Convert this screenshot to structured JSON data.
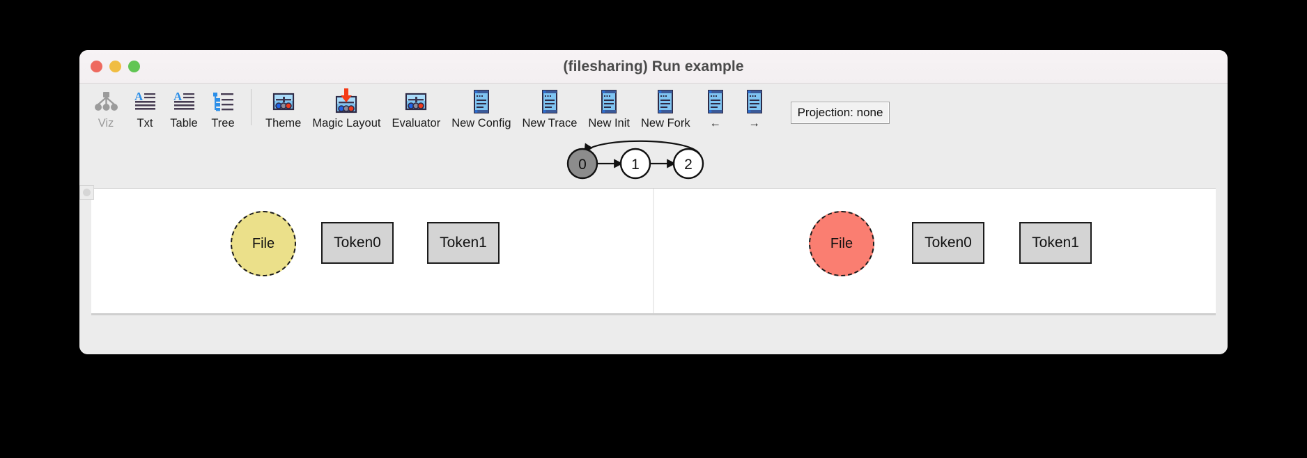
{
  "window": {
    "title": "(filesharing) Run example",
    "traffic_lights": [
      {
        "name": "close",
        "color": "#ee6a5f"
      },
      {
        "name": "minimize",
        "color": "#f0bd42"
      },
      {
        "name": "maximize",
        "color": "#61c554"
      }
    ]
  },
  "toolbar": {
    "items": [
      {
        "label": "Viz",
        "icon": "graph-tree-icon",
        "disabled": true
      },
      {
        "label": "Txt",
        "icon": "text-document-icon",
        "disabled": false
      },
      {
        "label": "Table",
        "icon": "text-table-icon",
        "disabled": false
      },
      {
        "label": "Tree",
        "icon": "tree-outline-icon",
        "disabled": false
      },
      {
        "label": "Theme",
        "icon": "theme-panel-icon",
        "disabled": false
      },
      {
        "label": "Magic Layout",
        "icon": "magic-layout-icon",
        "disabled": false
      },
      {
        "label": "Evaluator",
        "icon": "evaluator-panel-icon",
        "disabled": false
      },
      {
        "label": "New Config",
        "icon": "scroll-document-icon",
        "disabled": false
      },
      {
        "label": "New Trace",
        "icon": "scroll-document-icon",
        "disabled": false
      },
      {
        "label": "New Init",
        "icon": "scroll-document-icon",
        "disabled": false
      },
      {
        "label": "New Fork",
        "icon": "scroll-document-icon",
        "disabled": false
      },
      {
        "label": "←",
        "icon": "scroll-document-icon",
        "disabled": false
      },
      {
        "label": "→",
        "icon": "scroll-document-icon",
        "disabled": false
      }
    ],
    "separator_after_index": 3,
    "projection_label": "Projection: none"
  },
  "state_graph": {
    "nodes": [
      {
        "id": "0",
        "label": "0",
        "selected": true,
        "fill": "#8c8c8c"
      },
      {
        "id": "1",
        "label": "1",
        "selected": false,
        "fill": "#ffffff"
      },
      {
        "id": "2",
        "label": "2",
        "selected": false,
        "fill": "#ffffff"
      }
    ],
    "edges": [
      {
        "from": "0",
        "to": "1",
        "kind": "straight"
      },
      {
        "from": "1",
        "to": "2",
        "kind": "straight"
      },
      {
        "from": "2",
        "to": "0",
        "kind": "curved-back"
      }
    ]
  },
  "panes": {
    "left": {
      "name": "state-0-view",
      "file_node": {
        "label": "File",
        "fill": "#ebe08a"
      },
      "boxes": [
        {
          "label": "Token0",
          "fill": "#d4d4d4"
        },
        {
          "label": "Token1",
          "fill": "#d4d4d4"
        }
      ]
    },
    "right": {
      "name": "state-1-view",
      "file_node": {
        "label": "File",
        "fill": "#fa7e71"
      },
      "boxes": [
        {
          "label": "Token0",
          "fill": "#d4d4d4"
        },
        {
          "label": "Token1",
          "fill": "#d4d4d4"
        }
      ]
    }
  }
}
